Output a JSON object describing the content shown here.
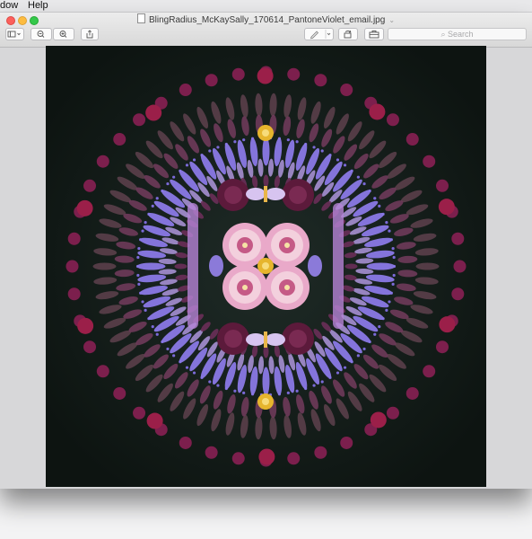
{
  "menubar": {
    "items": [
      {
        "label": "dow"
      },
      {
        "label": "Help"
      }
    ]
  },
  "window": {
    "title": "BlingRadius_McKaySally_170614_PantoneViolet_email.jpg",
    "title_chevron": "⌄",
    "toolbar": {
      "sidebar_icon": "sidebar-icon",
      "zoom_out_icon": "zoom-out-icon",
      "zoom_in_icon": "zoom-in-icon",
      "share_icon": "share-icon",
      "markup_icon": "pen-icon",
      "rotate_icon": "rotate-icon",
      "toolbox_icon": "toolbox-icon"
    },
    "search": {
      "placeholder": "Search",
      "value": ""
    }
  },
  "image": {
    "description_icon": "mandala-image",
    "colors": {
      "background": "#0d1411",
      "violet": "#8a79e6",
      "magenta": "#7c1f4d",
      "pink": "#e9a9c9",
      "gold": "#e6b52d"
    }
  }
}
